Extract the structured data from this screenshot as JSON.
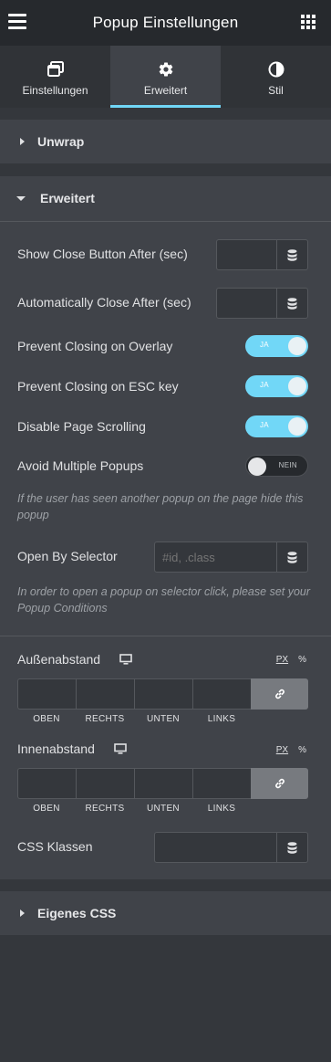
{
  "header": {
    "title": "Popup Einstellungen",
    "menu_icon": "hamburger-icon",
    "apps_icon": "grid-icon"
  },
  "tabs": [
    {
      "label": "Einstellungen",
      "icon": "window-icon"
    },
    {
      "label": "Erweitert",
      "icon": "gear-icon",
      "active": true
    },
    {
      "label": "Stil",
      "icon": "half-circle-icon"
    }
  ],
  "sections": {
    "unwrap": "Unwrap",
    "erweitert": "Erweitert",
    "eigenes_css": "Eigenes CSS"
  },
  "fields": {
    "show_close_after": {
      "label": "Show Close Button After (sec)",
      "value": ""
    },
    "auto_close_after": {
      "label": "Automatically Close After (sec)",
      "value": ""
    },
    "prevent_overlay": {
      "label": "Prevent Closing on Overlay",
      "state": "JA"
    },
    "prevent_esc": {
      "label": "Prevent Closing on ESC key",
      "state": "JA"
    },
    "disable_scroll": {
      "label": "Disable Page Scrolling",
      "state": "JA"
    },
    "avoid_multiple": {
      "label": "Avoid Multiple Popups",
      "state": "NEIN",
      "note": "If the user has seen another popup on the page hide this popup"
    },
    "open_by_selector": {
      "label": "Open By Selector",
      "placeholder": "#id, .class",
      "note": "In order to open a popup on selector click, please set your Popup Conditions"
    },
    "margin": {
      "label": "Außenabstand",
      "unit_px": "PX",
      "unit_pct": "%"
    },
    "padding": {
      "label": "Innenabstand",
      "unit_px": "PX",
      "unit_pct": "%"
    },
    "css_classes": {
      "label": "CSS Klassen",
      "value": ""
    }
  },
  "dimension_labels": [
    "OBEN",
    "RECHTS",
    "UNTEN",
    "LINKS"
  ],
  "colors": {
    "accent": "#71d7f7",
    "panel": "#404349",
    "background": "#34373c",
    "header": "#26292d"
  }
}
